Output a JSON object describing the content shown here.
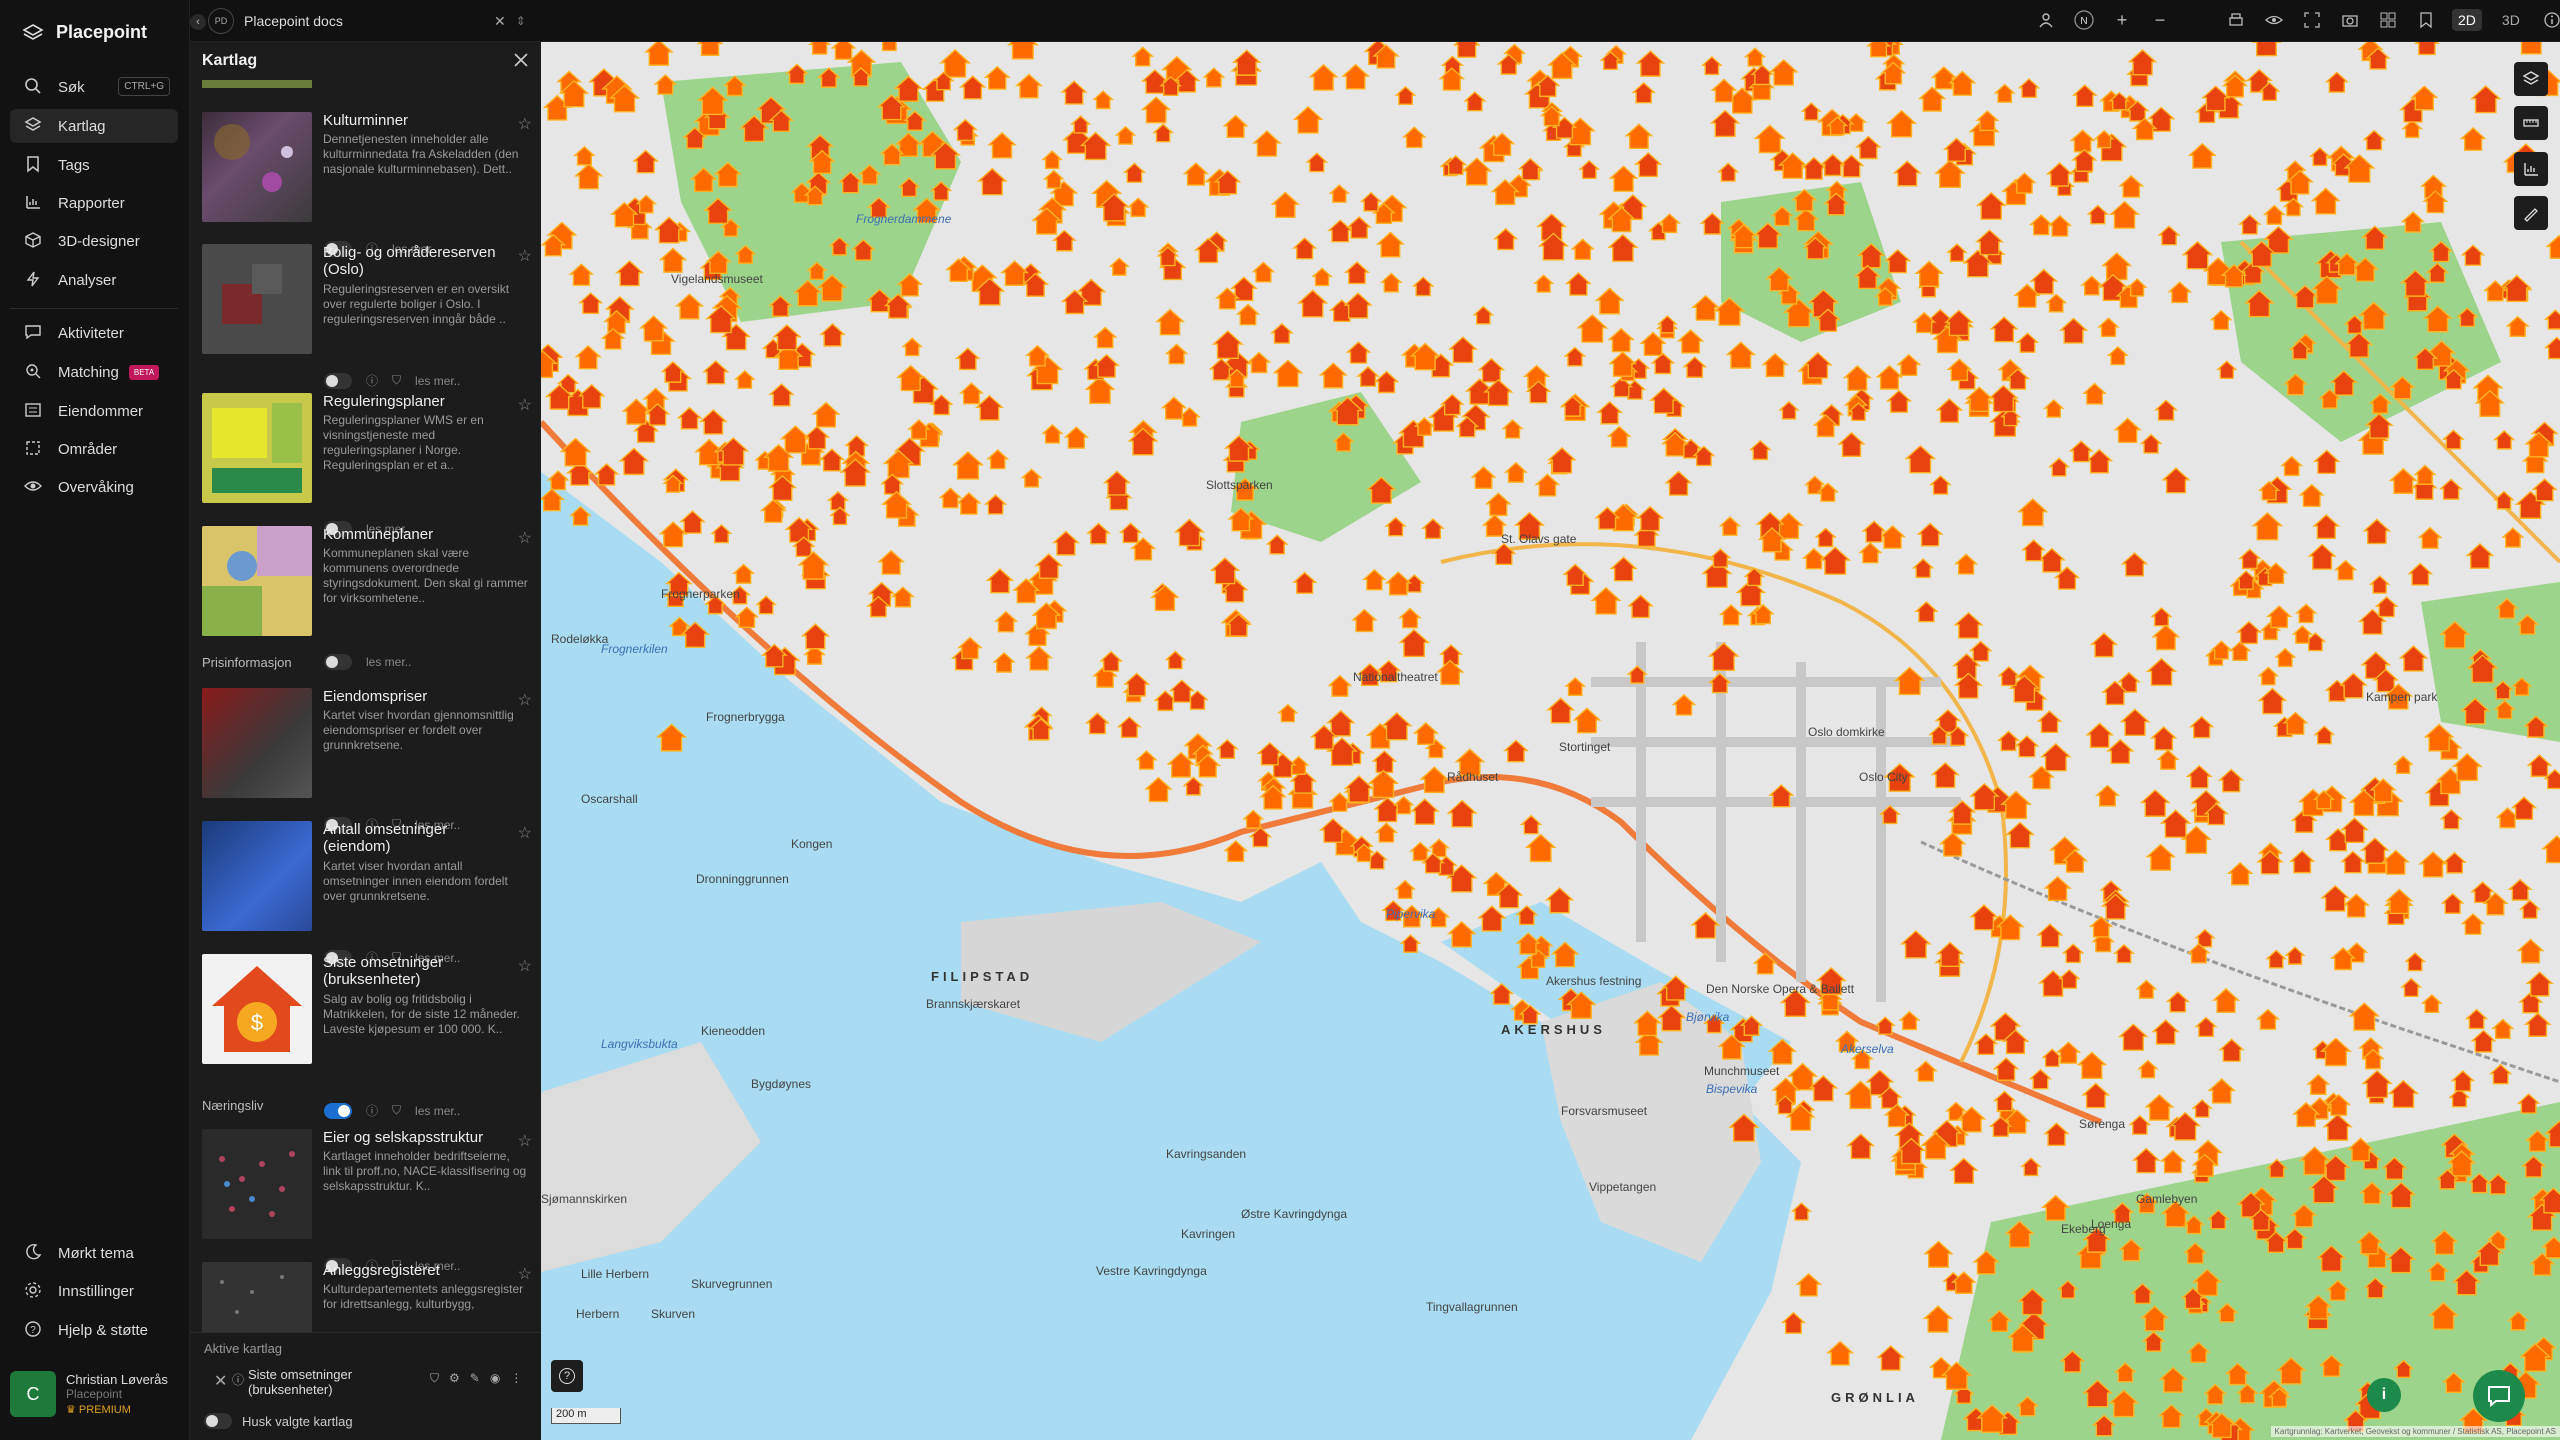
{
  "app": {
    "name": "Placepoint"
  },
  "nav": {
    "items": [
      {
        "label": "Søk",
        "shortcut": "CTRL+G",
        "icon": "search-icon"
      },
      {
        "label": "Kartlag",
        "icon": "layers-icon"
      },
      {
        "label": "Tags",
        "icon": "bookmark-icon"
      },
      {
        "label": "Rapporter",
        "icon": "report-icon"
      },
      {
        "label": "3D-designer",
        "icon": "cube-icon"
      },
      {
        "label": "Analyser",
        "icon": "bolt-icon"
      },
      {
        "label": "Aktiviteter",
        "icon": "chat-icon"
      },
      {
        "label": "Matching",
        "badge": "BETA",
        "icon": "match-icon"
      },
      {
        "label": "Eiendommer",
        "icon": "list-icon"
      },
      {
        "label": "Områder",
        "icon": "area-icon"
      },
      {
        "label": "Overvåking",
        "icon": "eye-icon"
      }
    ],
    "bottom": [
      {
        "label": "Mørkt tema",
        "icon": "moon-icon"
      },
      {
        "label": "Innstillinger",
        "icon": "gear-icon"
      },
      {
        "label": "Hjelp & støtte",
        "icon": "help-icon"
      }
    ],
    "user": {
      "initial": "C",
      "name": "Christian Løverås",
      "org": "Placepoint",
      "plan": "PREMIUM"
    }
  },
  "topbar": {
    "doc_badge": "PD",
    "doc_title": "Placepoint docs",
    "mode_2d": "2D",
    "mode_3d": "3D",
    "north": "N"
  },
  "panel": {
    "title": "Kartlag",
    "read_more": "les mer..",
    "cards": [
      {
        "title": "Kulturminner",
        "desc": "Dennetjenesten inneholder alle kulturminnedata fra Askeladden (den nasjonale kulturminnebasen). Dett..",
        "on": false
      },
      {
        "title": "Bolig- og områdereserven (Oslo)",
        "desc": "Reguleringsreserven er en oversikt over regulerte boliger i Oslo. I reguleringsreserven inngår både ..",
        "on": false
      },
      {
        "title": "Reguleringsplaner",
        "desc": "Reguleringsplaner WMS er en visningstjeneste med reguleringsplaner i Norge. Reguleringsplan er et a..",
        "on": false
      },
      {
        "title": "Kommuneplaner",
        "desc": "Kommuneplanen skal være kommunens overordnede styringsdokument. Den skal gi rammer for virksomhetene..",
        "on": false
      },
      {
        "title": "Eiendomspriser",
        "desc": "Kartet viser hvordan gjennomsnittlig eiendomspriser er fordelt over grunnkretsene.",
        "on": false
      },
      {
        "title": "Antall omsetninger (eiendom)",
        "desc": "Kartet viser hvordan antall omsetninger innen eiendom fordelt over grunnkretsene.",
        "on": false
      },
      {
        "title": "Siste omsetninger (bruksenheter)",
        "desc": "Salg av bolig og fritidsbolig i Matrikkelen, for de siste 12 måneder. Laveste kjøpesum er 100 000. K..",
        "on": true
      },
      {
        "title": "Eier og selskapsstruktur",
        "desc": "Kartlaget inneholder bedriftseierne, link til proff.no, NACE-klassifisering og selskapsstruktur. K..",
        "on": false
      },
      {
        "title": "Anleggsregisteret",
        "desc": "Kulturdepartementets anleggsregister for idrettsanlegg, kulturbygg,",
        "on": false
      }
    ],
    "sections": [
      "Prisinformasjon",
      "Næringsliv"
    ],
    "active_title": "Aktive kartlag",
    "active_layer": "Siste omsetninger (bruksenheter)",
    "remember_label": "Husk valgte kartlag"
  },
  "map": {
    "scale": "200 m",
    "attribution": "Kartgrunnlag: Kartverket, Geovekst og kommuner / Statistisk AS, Placepoint AS",
    "labels": [
      {
        "text": "Frognerdammene",
        "kind": "water"
      },
      {
        "text": "Frognerkilen",
        "kind": "water"
      },
      {
        "text": "Frognerbrygga",
        "kind": "normal"
      },
      {
        "text": "Frognerparken",
        "kind": "normal"
      },
      {
        "text": "Rodeløkka",
        "kind": "normal"
      },
      {
        "text": "Oscarshall",
        "kind": "normal"
      },
      {
        "text": "Kongen",
        "kind": "normal"
      },
      {
        "text": "Dronninggrunnen",
        "kind": "normal"
      },
      {
        "text": "Langviksbukta",
        "kind": "water"
      },
      {
        "text": "Kieneodden",
        "kind": "normal"
      },
      {
        "text": "Bygdøynes",
        "kind": "normal"
      },
      {
        "text": "Sjømannskirken",
        "kind": "normal"
      },
      {
        "text": "Lille Herbern",
        "kind": "normal"
      },
      {
        "text": "Herbern",
        "kind": "normal"
      },
      {
        "text": "Skurven",
        "kind": "normal"
      },
      {
        "text": "Skurvegrunnen",
        "kind": "normal"
      },
      {
        "text": "Kavringsanden",
        "kind": "normal"
      },
      {
        "text": "Kavringen",
        "kind": "normal"
      },
      {
        "text": "Østre Kavringdynga",
        "kind": "normal"
      },
      {
        "text": "Vestre Kavringdynga",
        "kind": "normal"
      },
      {
        "text": "Tingvallagrunnen",
        "kind": "normal"
      },
      {
        "text": "Pipervika",
        "kind": "water"
      },
      {
        "text": "Bjørvika",
        "kind": "water"
      },
      {
        "text": "Bispevika",
        "kind": "water"
      },
      {
        "text": "FILIPSTAD",
        "kind": "big"
      },
      {
        "text": "AKERSHUS",
        "kind": "big"
      },
      {
        "text": "GRØNLIA",
        "kind": "big"
      },
      {
        "text": "Brannskjærskaret",
        "kind": "normal"
      },
      {
        "text": "Akershus festning",
        "kind": "normal"
      },
      {
        "text": "Forsvarsmuseet",
        "kind": "normal"
      },
      {
        "text": "Vippetangen",
        "kind": "normal"
      },
      {
        "text": "Munchmuseet",
        "kind": "normal"
      },
      {
        "text": "Den Norske Opera & Ballett",
        "kind": "normal"
      },
      {
        "text": "Oslo City",
        "kind": "normal"
      },
      {
        "text": "Oslo domkirke",
        "kind": "normal"
      },
      {
        "text": "Stortinget",
        "kind": "normal"
      },
      {
        "text": "Rådhuset",
        "kind": "normal"
      },
      {
        "text": "Nationaltheatret",
        "kind": "normal"
      },
      {
        "text": "Slottsparken",
        "kind": "normal"
      },
      {
        "text": "Vigelandsmuseet",
        "kind": "normal"
      },
      {
        "text": "St. Olavs gate",
        "kind": "normal"
      },
      {
        "text": "Kampen park",
        "kind": "normal"
      },
      {
        "text": "Ekeberg",
        "kind": "normal"
      },
      {
        "text": "Gamlebyen",
        "kind": "normal"
      },
      {
        "text": "Loenga",
        "kind": "normal"
      },
      {
        "text": "Sørenga",
        "kind": "normal"
      },
      {
        "text": "Akerselva",
        "kind": "water"
      }
    ]
  },
  "colors": {
    "accent": "#1a6fd0",
    "marker": "#ff6a00",
    "water": "#a9dcf2",
    "park": "#8fd07a",
    "land": "#e8e8e8"
  }
}
